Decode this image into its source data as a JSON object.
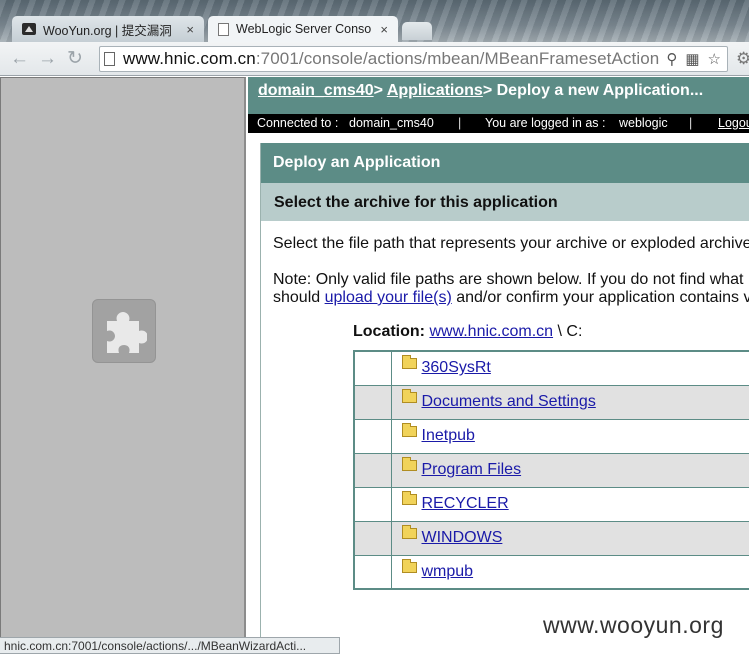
{
  "browser": {
    "tabs": [
      {
        "title": "WooYun.org | 提交漏洞",
        "active": false,
        "icon": "wooyun-favicon"
      },
      {
        "title": "WebLogic Server Conso",
        "active": true,
        "icon": "page-favicon"
      }
    ],
    "close_glyph": "×",
    "url_host": "www.hnic.com.cn",
    "url_rest": ":7001/console/actions/mbean/MBeanFramesetAction",
    "status_url": "hnic.com.cn:7001/console/actions/.../MBeanWizardActi..."
  },
  "console": {
    "breadcrumb": {
      "domain": "domain_cms40",
      "sep1": "> ",
      "applications": "Applications",
      "current": "> Deploy a new Application..."
    },
    "status": {
      "connected_label": "Connected to :",
      "connected_value": "domain_cms40",
      "logged_label": "You are logged in as :",
      "logged_value": "weblogic",
      "separator": "|",
      "logout": "Logout"
    },
    "panel_title": "Deploy an Application",
    "panel_subtitle": "Select the archive for this application",
    "instructions": "Select the file path that represents your archive or exploded archive",
    "note_prefix": "Note: Only valid file paths are shown below. If you do not find what",
    "note_line2_start": "should ",
    "note_link": "upload your file(s)",
    "note_line2_end": " and/or confirm your application contains v",
    "location_label": "Location:",
    "location_host": "www.hnic.com.cn",
    "location_path": " \\ C:",
    "folders": [
      "360SysRt",
      "Documents and Settings",
      "Inetpub",
      "Program Files",
      "RECYCLER",
      "WINDOWS",
      "wmpub"
    ]
  },
  "watermark": "www.wooyun.org",
  "colors": {
    "teal": "#5c8c86",
    "light_teal": "#b8cccb",
    "link": "#1a1aa8"
  }
}
